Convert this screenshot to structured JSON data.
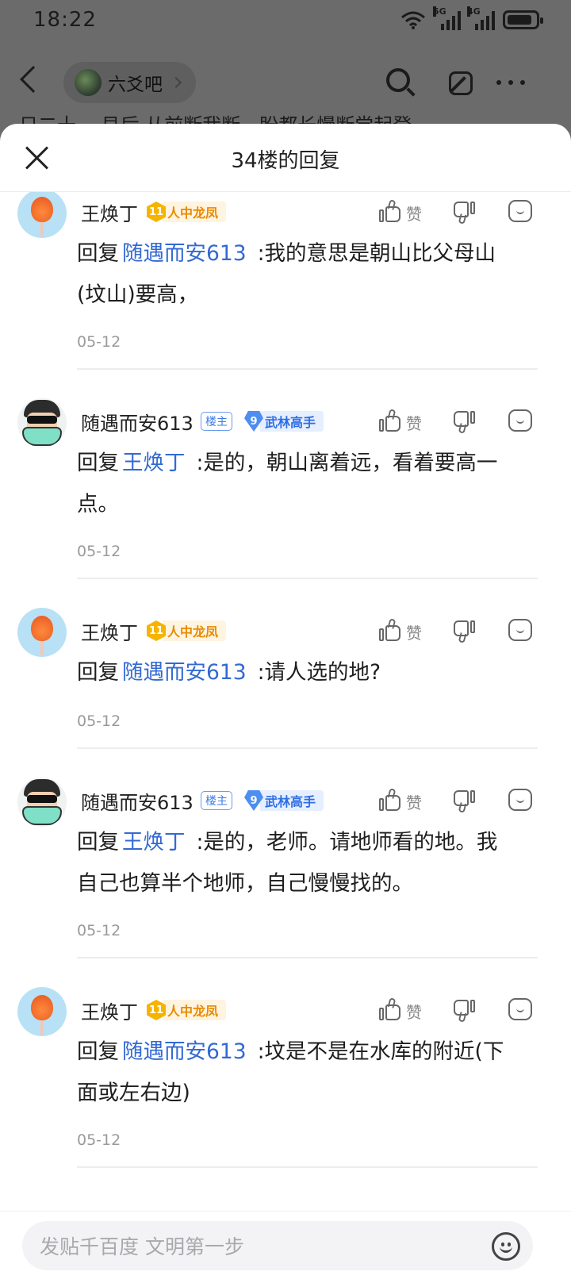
{
  "status_bar": {
    "time": "18:22",
    "wifi_icon": "wifi-icon",
    "signal_1_label": "5G",
    "signal_2_label": "4G",
    "battery_icon": "battery-icon"
  },
  "background_nav": {
    "back_icon": "chevron-left-icon",
    "forum_name": "六爻吧",
    "search_icon": "search-icon",
    "edit_icon": "edit-icon",
    "more_icon": "more-icon",
    "peek_text": "日二十一 艮后 从前断我断，盼都长慢断尝起登~"
  },
  "sheet": {
    "title": "34楼的回复",
    "close_icon": "close-icon",
    "like_label": "赞",
    "reply_prefix": "回复"
  },
  "replies": [
    {
      "user": "王焕丁",
      "avatar": "avatar-ice-cream",
      "level": "11",
      "badge": "人中龙凤",
      "mention": "随遇而安613",
      "text_line1": ":我的意思是朝山比父母山",
      "text_line2": "(坟山)要高，",
      "date": "05-12"
    },
    {
      "user": "随遇而安613",
      "avatar": "avatar-mask",
      "op_tag": "楼主",
      "level": "9",
      "badge": "武林高手",
      "mention": "王焕丁",
      "text_line1": ":是的，朝山离着远，看着要高一",
      "text_line2": "点。",
      "date": "05-12"
    },
    {
      "user": "王焕丁",
      "avatar": "avatar-ice-cream",
      "level": "11",
      "badge": "人中龙凤",
      "mention": "随遇而安613",
      "text_line1": ":请人选的地?",
      "text_line2": "",
      "date": "05-12"
    },
    {
      "user": "随遇而安613",
      "avatar": "avatar-mask",
      "op_tag": "楼主",
      "level": "9",
      "badge": "武林高手",
      "mention": "王焕丁",
      "text_line1": ":是的，老师。请地师看的地。我",
      "text_line2": "自己也算半个地师，自己慢慢找的。",
      "date": "05-12"
    },
    {
      "user": "王焕丁",
      "avatar": "avatar-ice-cream",
      "level": "11",
      "badge": "人中龙凤",
      "mention": "随遇而安613",
      "text_line1": ":坟是不是在水库的附近(下",
      "text_line2": "面或左右边)",
      "date": "05-12"
    }
  ],
  "composer": {
    "placeholder": "发贴千百度 文明第一步",
    "emoji_icon": "emoji-icon"
  }
}
